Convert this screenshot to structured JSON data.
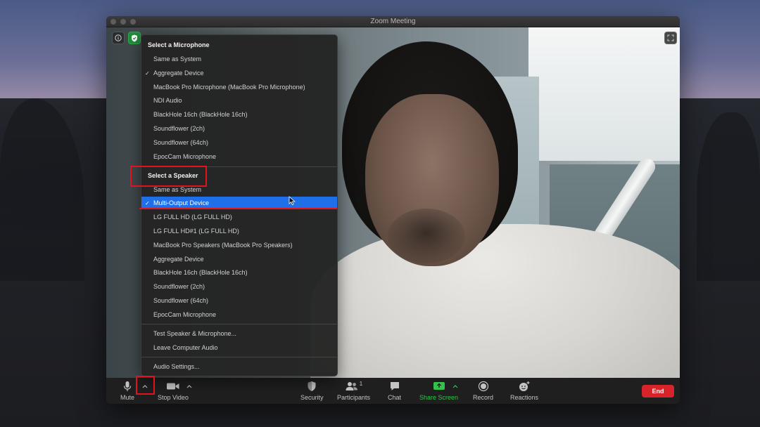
{
  "window": {
    "title": "Zoom Meeting"
  },
  "audio_menu": {
    "microphone_header": "Select a Microphone",
    "microphones": [
      {
        "label": "Same as System",
        "checked": false
      },
      {
        "label": "Aggregate Device",
        "checked": true
      },
      {
        "label": "MacBook Pro Microphone (MacBook Pro Microphone)",
        "checked": false
      },
      {
        "label": "NDI Audio",
        "checked": false
      },
      {
        "label": "BlackHole 16ch (BlackHole 16ch)",
        "checked": false
      },
      {
        "label": "Soundflower (2ch)",
        "checked": false
      },
      {
        "label": "Soundflower (64ch)",
        "checked": false
      },
      {
        "label": "EpocCam Microphone",
        "checked": false
      }
    ],
    "speaker_header": "Select a Speaker",
    "speakers": [
      {
        "label": "Same as System",
        "checked": false
      },
      {
        "label": "Multi-Output Device",
        "checked": true
      },
      {
        "label": "LG FULL HD (LG FULL HD)",
        "checked": false
      },
      {
        "label": "LG FULL HD#1 (LG FULL HD)",
        "checked": false
      },
      {
        "label": "MacBook Pro Speakers (MacBook Pro Speakers)",
        "checked": false
      },
      {
        "label": "Aggregate Device",
        "checked": false
      },
      {
        "label": "BlackHole 16ch (BlackHole 16ch)",
        "checked": false
      },
      {
        "label": "Soundflower (2ch)",
        "checked": false
      },
      {
        "label": "Soundflower (64ch)",
        "checked": false
      },
      {
        "label": "EpocCam Microphone",
        "checked": false
      }
    ],
    "check_glyph": "✓",
    "test_speaker": "Test Speaker & Microphone...",
    "leave_audio": "Leave Computer Audio",
    "audio_settings": "Audio Settings..."
  },
  "toolbar": {
    "mute": "Mute",
    "stop_video": "Stop Video",
    "security": "Security",
    "participants": "Participants",
    "participants_count": "1",
    "chat": "Chat",
    "share_screen": "Share Screen",
    "record": "Record",
    "reactions": "Reactions",
    "end": "End"
  },
  "colors": {
    "share_green": "#35c24a",
    "selected_blue": "#1f6fe8",
    "end_red": "#d7242a",
    "annotation_red": "#e2121f"
  }
}
